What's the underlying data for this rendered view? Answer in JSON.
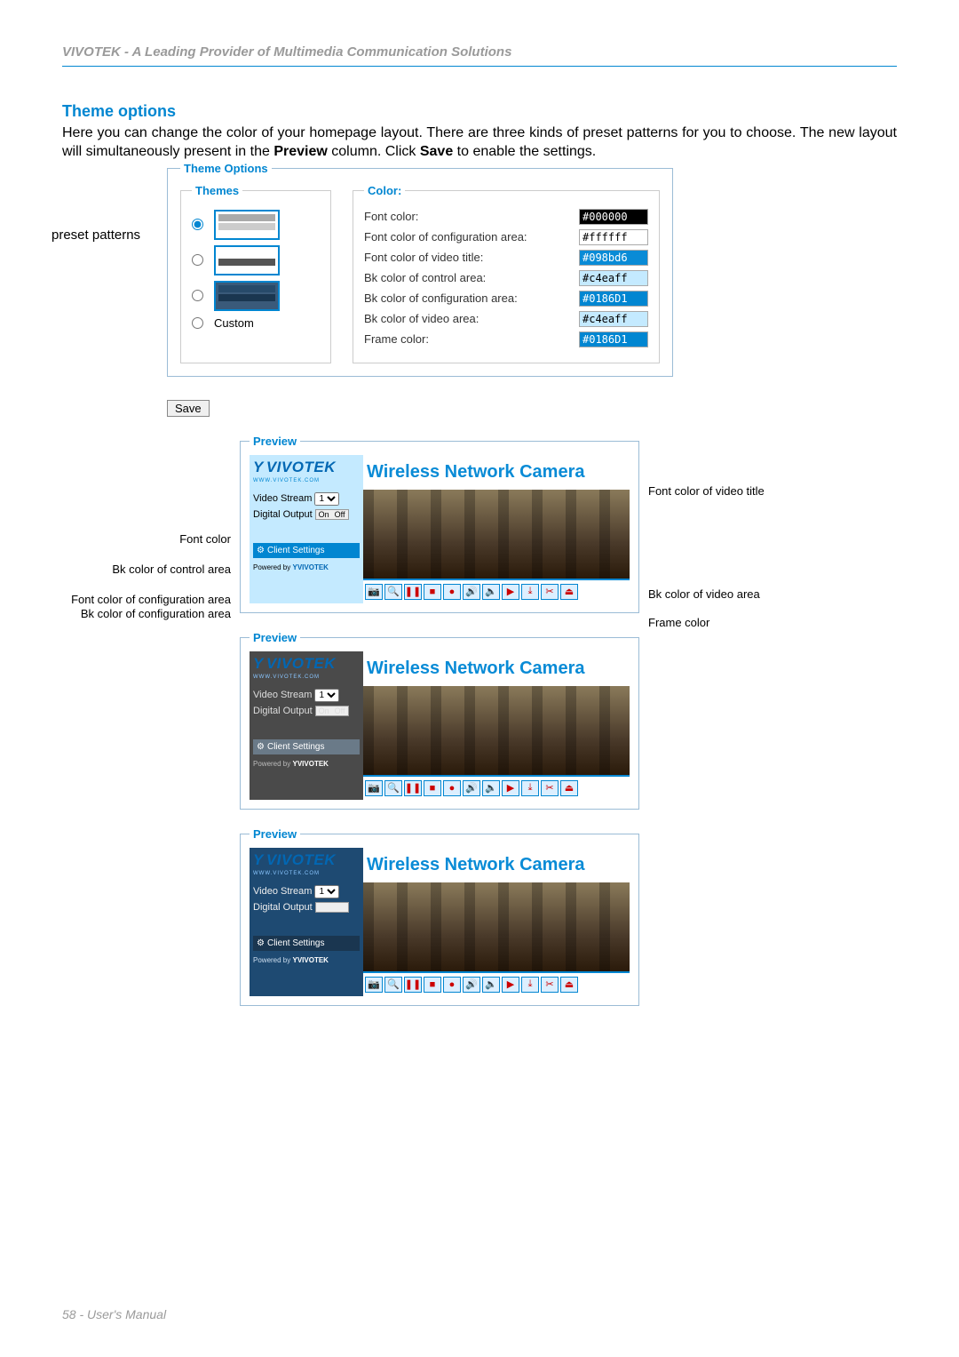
{
  "header": "VIVOTEK - A Leading Provider of Multimedia Communication Solutions",
  "section_title": "Theme options",
  "body_text_1": "Here you can change the color of your homepage layout. There are three kinds of preset patterns for you to choose. The new layout will simultaneously present in the ",
  "body_bold_1": "Preview",
  "body_text_2": " column. Click ",
  "body_bold_2": "Save",
  "body_text_3": " to enable the settings.",
  "annotations": {
    "preset_patterns": "preset patterns",
    "font_color": "Font color",
    "bk_control": "Bk color of control area",
    "font_config": "Font color of configuration area",
    "bk_config": "Bk color of configuration area",
    "font_video_title": "Font color of video title",
    "bk_video": "Bk color of video area",
    "frame_color": "Frame color"
  },
  "theme_options_legend": "Theme Options",
  "themes_legend": "Themes",
  "custom_label": "Custom",
  "color_legend": "Color:",
  "color_rows": [
    {
      "label": "Font color:",
      "value": "#000000",
      "cls": "c1"
    },
    {
      "label": "Font color of configuration area:",
      "value": "#ffffff",
      "cls": ""
    },
    {
      "label": "Font color of video title:",
      "value": "#098bd6",
      "cls": "c3"
    },
    {
      "label": "Bk color of control area:",
      "value": "#c4eaff",
      "cls": "c4"
    },
    {
      "label": "Bk color of configuration area:",
      "value": "#0186D1",
      "cls": "c5"
    },
    {
      "label": "Bk color of video area:",
      "value": "#c4eaff",
      "cls": "c4"
    },
    {
      "label": "Frame color:",
      "value": "#0186D1",
      "cls": "c5"
    }
  ],
  "save": "Save",
  "preview_legend": "Preview",
  "pv": {
    "brand": "VIVOTEK",
    "brand_sub": "WWW.VIVOTEK.COM",
    "title": "Wireless Network Camera",
    "video_stream": "Video Stream",
    "stream_value": "1",
    "digital_output": "Digital Output",
    "on": "On",
    "off": "Off",
    "client_settings": "Client Settings",
    "powered_by": "Powered by",
    "brand_small": "VIVOTEK"
  },
  "toolbar_icons": [
    "📷",
    "🔍",
    "❚❚",
    "■",
    "●",
    "🔊",
    "🔈",
    "▶",
    "⤓",
    "✂",
    "⏏"
  ],
  "footer": "58 - User's Manual"
}
